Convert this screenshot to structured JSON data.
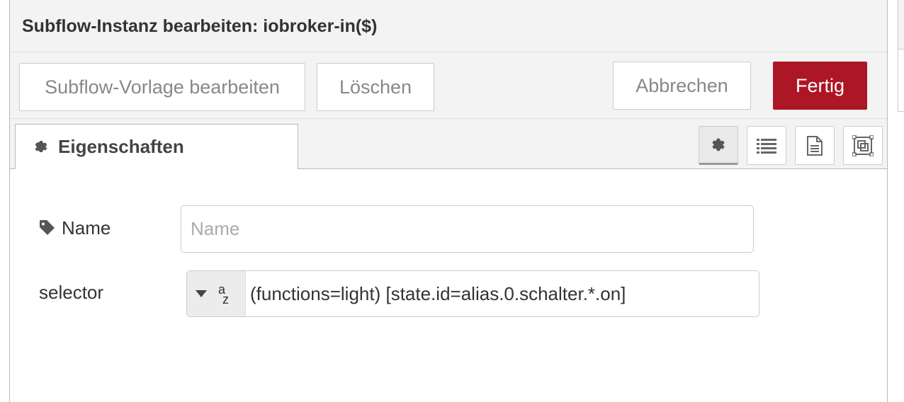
{
  "dialog": {
    "title": "Subflow-Instanz bearbeiten: iobroker-in($)"
  },
  "toolbar": {
    "edit_template_label": "Subflow-Vorlage bearbeiten",
    "delete_label": "Löschen",
    "cancel_label": "Abbrechen",
    "done_label": "Fertig"
  },
  "tabs": {
    "properties_label": "Eigenschaften",
    "icons": [
      "gear-icon",
      "list-icon",
      "document-icon",
      "frame-icon"
    ]
  },
  "form": {
    "name": {
      "label": "Name",
      "placeholder": "Name",
      "value": ""
    },
    "selector": {
      "label": "selector",
      "type_glyph_top": "a",
      "type_glyph_bottom": "z",
      "value": "(functions=light) [state.id=alias.0.schalter.*.on]"
    }
  },
  "colors": {
    "primary": "#ad1625",
    "header_bg": "#f3f3f3"
  }
}
